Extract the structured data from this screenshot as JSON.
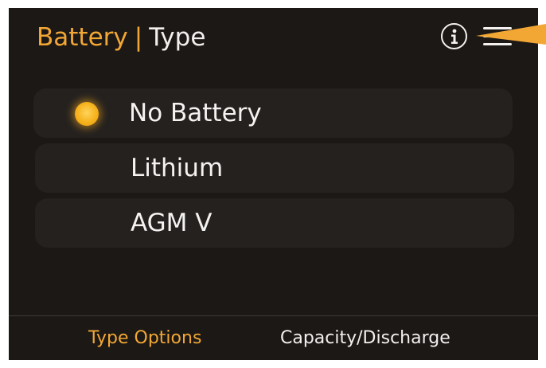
{
  "header": {
    "title_accent": "Battery",
    "title_separator": "|",
    "title_sub": "Type",
    "info_icon": "info-circle-icon",
    "menu_icon": "hamburger-menu-icon"
  },
  "options": [
    {
      "label": "No Battery",
      "selected": true
    },
    {
      "label": "Lithium",
      "selected": false
    },
    {
      "label": "AGM V",
      "selected": false
    }
  ],
  "footer": {
    "tabs": [
      {
        "label": "Type Options",
        "active": true
      },
      {
        "label": "Capacity/Discharge",
        "active": false
      }
    ]
  },
  "colors": {
    "background": "#1b1816",
    "item_background": "#24211f",
    "accent": "#f2a735",
    "text": "#f5f3f1",
    "callout": "#f2a735"
  }
}
